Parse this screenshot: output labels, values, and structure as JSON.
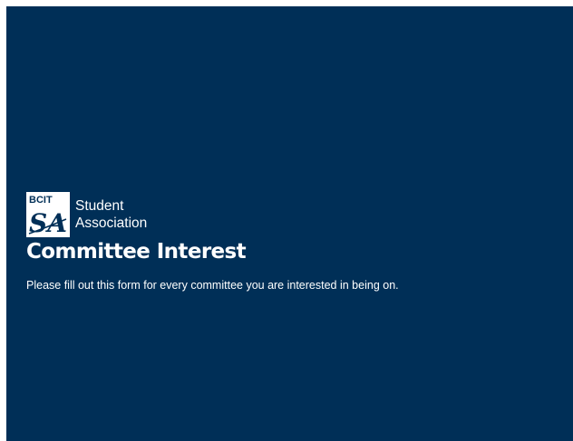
{
  "colors": {
    "background": "#002f57",
    "text": "#ffffff",
    "border": "#ffffff"
  },
  "logo": {
    "mark_small_text": "BCIT",
    "mark_initials": "SA",
    "line1": "Student",
    "line2": "Association"
  },
  "form": {
    "title": "Committee Interest",
    "description": "Please fill out this form for every committee you are interested in being on."
  }
}
